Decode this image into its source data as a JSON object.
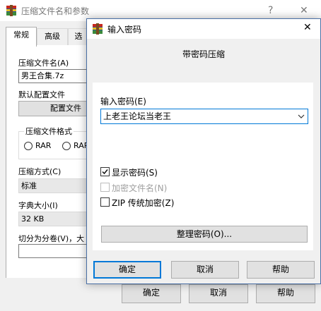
{
  "back_window": {
    "title": "压缩文件名和参数",
    "help_glyph": "?",
    "close_glyph": "✕",
    "tabs": [
      "常规",
      "高级",
      "选"
    ],
    "archive_name_label": "压缩文件名(A)",
    "archive_name_value": "男王合集.7z",
    "default_profile_label": "默认配置文件",
    "profile_button": "配置文件",
    "format_group_label": "压缩文件格式",
    "format_options": [
      "RAR",
      "RAR"
    ],
    "method_label": "压缩方式(C)",
    "method_value": "标准",
    "dict_label": "字典大小(I)",
    "dict_value": "32 KB",
    "split_label": "切分为分卷(V)，大",
    "buttons": {
      "ok": "确定",
      "cancel": "取消",
      "help": "帮助"
    }
  },
  "dialog": {
    "title": "输入密码",
    "close_glyph": "✕",
    "heading": "带密码压缩",
    "password_label": "输入密码(E)",
    "password_value": "上老王论坛当老王",
    "show_password_label": "显示密码(S)",
    "show_password_checked": true,
    "encrypt_names_label": "加密文件名(N)",
    "encrypt_names_enabled": false,
    "zip_legacy_label": "ZIP 传统加密(Z)",
    "zip_legacy_checked": false,
    "organize_button": "整理密码(O)...",
    "buttons": {
      "ok": "确定",
      "cancel": "取消",
      "help": "帮助"
    }
  },
  "colors": {
    "accent": "#0078d7",
    "dialog_border": "#4a6fa5",
    "winrar_red": "#c8281e",
    "winrar_blue": "#2a4f9e"
  }
}
